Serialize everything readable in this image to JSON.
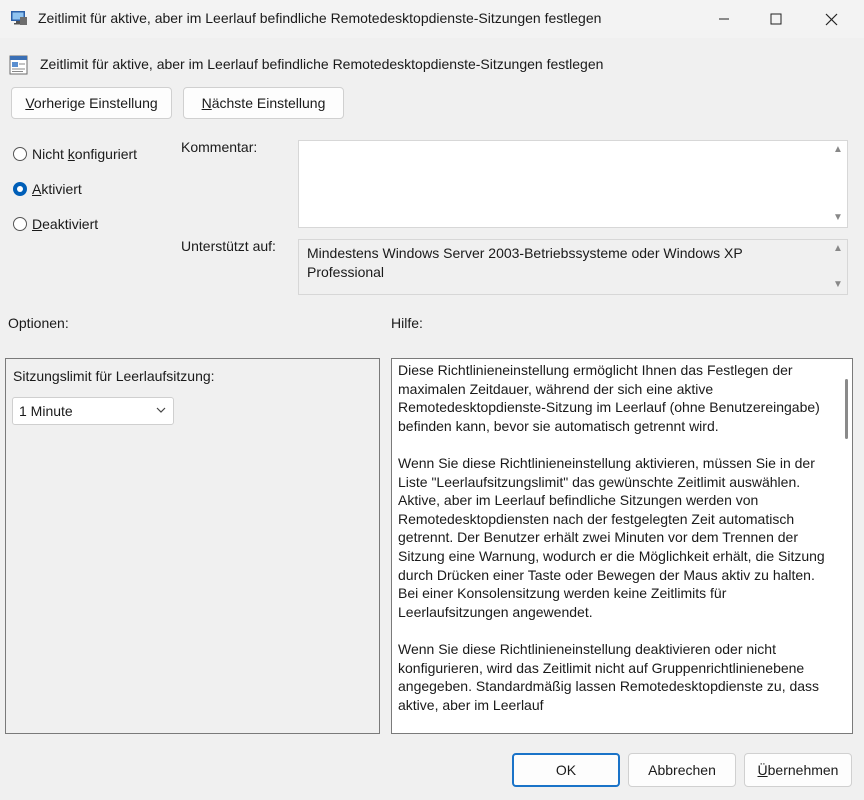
{
  "window": {
    "title": "Zeitlimit für aktive, aber im Leerlauf befindliche Remotedesktopdienste-Sitzungen festlegen"
  },
  "header": {
    "title": "Zeitlimit für aktive, aber im Leerlauf befindliche Remotedesktopdienste-Sitzungen festlegen"
  },
  "nav": {
    "prev_first": "V",
    "prev_rest": "orherige Einstellung",
    "next_first": "N",
    "next_rest": "ächste Einstellung"
  },
  "state": {
    "radios": [
      {
        "before": "Nicht ",
        "mnemonic": "k",
        "after": "onfiguriert",
        "selected": false
      },
      {
        "before": "",
        "mnemonic": "A",
        "after": "ktiviert",
        "selected": true
      },
      {
        "before": "",
        "mnemonic": "D",
        "after": "eaktiviert",
        "selected": false
      }
    ]
  },
  "comment": {
    "label": "Kommentar:",
    "value": ""
  },
  "supported": {
    "label": "Unterstützt auf:",
    "value": "Mindestens Windows Server 2003-Betriebssysteme oder Windows XP Professional"
  },
  "options": {
    "label": "Optionen:",
    "idle_limit_label": "Sitzungslimit für Leerlaufsitzung:",
    "idle_limit_value": "1 Minute"
  },
  "help": {
    "label": "Hilfe:",
    "paragraphs": [
      "Diese Richtlinieneinstellung ermöglicht Ihnen das Festlegen der maximalen Zeitdauer, während der sich eine aktive Remotedesktopdienste-Sitzung im Leerlauf (ohne Benutzereingabe) befinden kann, bevor sie automatisch getrennt wird.",
      "Wenn Sie diese Richtlinieneinstellung aktivieren, müssen Sie in der Liste \"Leerlaufsitzungslimit\" das gewünschte Zeitlimit auswählen. Aktive, aber im Leerlauf befindliche Sitzungen werden von Remotedesktopdiensten nach der festgelegten Zeit automatisch getrennt. Der Benutzer erhält zwei Minuten vor dem Trennen der Sitzung eine Warnung, wodurch er die Möglichkeit erhält, die Sitzung durch Drücken einer Taste oder Bewegen der Maus aktiv zu halten. Bei einer Konsolensitzung werden keine Zeitlimits für Leerlaufsitzungen angewendet.",
      "Wenn Sie diese Richtlinieneinstellung deaktivieren oder nicht konfigurieren, wird das Zeitlimit nicht auf Gruppenrichtlinienebene angegeben. Standardmäßig lassen Remotedesktopdienste zu, dass aktive, aber im Leerlauf"
    ]
  },
  "footer": {
    "ok": "OK",
    "cancel": "Abbrechen",
    "apply_first": "Ü",
    "apply_rest": "bernehmen"
  },
  "icons": {
    "title": "remote-desktop-icon",
    "header": "policy-setting-icon",
    "minimize": "minimize-icon",
    "maximize": "maximize-icon",
    "close": "close-icon",
    "dropdown": "chevron-down-icon"
  },
  "colors": {
    "accent": "#005fb8",
    "ok_border": "#1a73c8"
  }
}
